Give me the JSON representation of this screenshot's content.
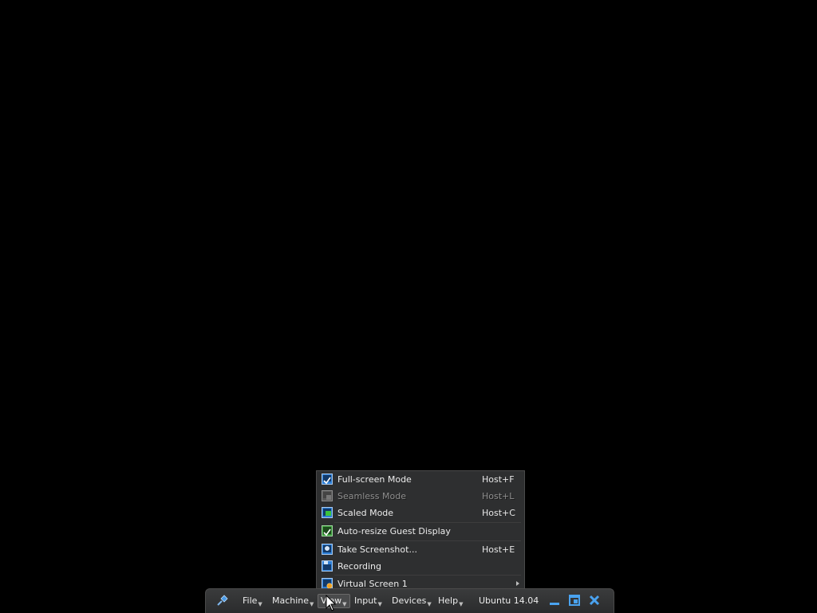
{
  "view_menu": {
    "items": [
      {
        "label": "Full-screen Mode",
        "shortcut": "Host+F",
        "icon": "fullscreen-icon",
        "enabled": true
      },
      {
        "label": "Seamless Mode",
        "shortcut": "Host+L",
        "icon": "seamless-icon",
        "enabled": false
      },
      {
        "label": "Scaled Mode",
        "shortcut": "Host+C",
        "icon": "scaled-icon",
        "enabled": true
      },
      {
        "label": "Auto-resize Guest Display",
        "shortcut": "",
        "icon": "auto-resize-icon",
        "enabled": true
      },
      {
        "label": "Take Screenshot...",
        "shortcut": "Host+E",
        "icon": "screenshot-icon",
        "enabled": true
      },
      {
        "label": "Recording",
        "shortcut": "",
        "icon": "recording-icon",
        "enabled": true
      },
      {
        "label": "Virtual Screen 1",
        "shortcut": "",
        "icon": "virtual-screen-icon",
        "enabled": true,
        "has_submenu": true
      }
    ]
  },
  "toolbar": {
    "pin_icon": "pin-icon",
    "menus": [
      {
        "label": "File"
      },
      {
        "label": "Machine"
      },
      {
        "label": "View"
      },
      {
        "label": "Input"
      },
      {
        "label": "Devices"
      },
      {
        "label": "Help"
      }
    ],
    "vm_name": "Ubuntu 14.04",
    "window_controls": [
      "minimize-icon",
      "restore-icon",
      "close-icon"
    ]
  },
  "colors": {
    "background": "#000000",
    "menu_bg": "#2e2f30",
    "toolbar_bg": "#333435",
    "icon_blue": "#2d7fd6",
    "icon_green": "#3cc43c"
  }
}
